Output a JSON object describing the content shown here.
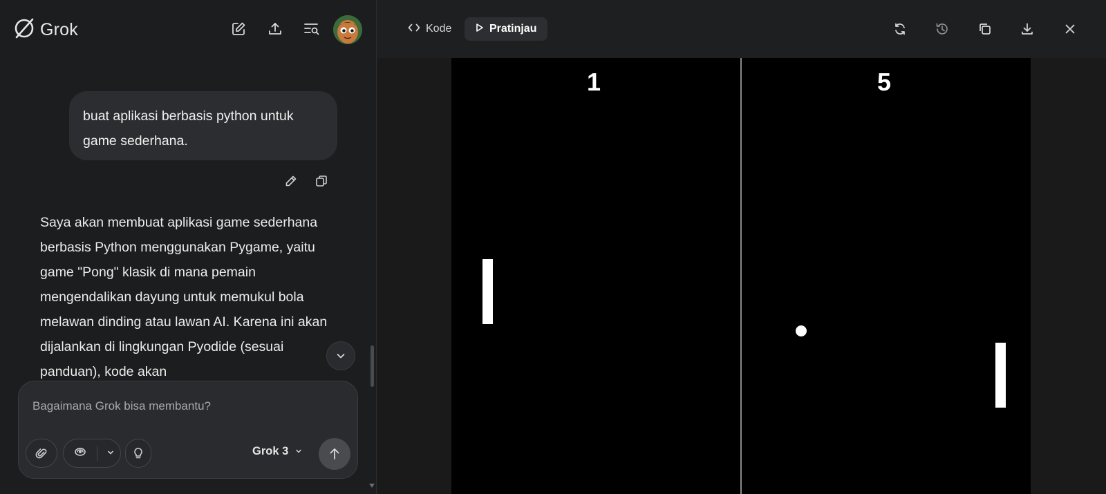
{
  "app": {
    "brand": "Grok",
    "avatar_icon": "user-avatar"
  },
  "header": {
    "icons": [
      "edit-icon",
      "share-icon",
      "search-history-icon"
    ]
  },
  "chat": {
    "user_message": "buat aplikasi berbasis python untuk game sederhana.",
    "message_actions": [
      "edit-icon",
      "copy-icon"
    ],
    "assistant_message": "Saya akan membuat aplikasi game sederhana berbasis Python menggunakan Pygame, yaitu game \"Pong\" klasik di mana pemain mengendalikan dayung untuk memukul bola melawan dinding atau lawan AI. Karena ini akan dijalankan di lingkungan Pyodide (sesuai panduan), kode akan"
  },
  "composer": {
    "placeholder": "Bagaimana Grok bisa membantu?",
    "model_label": "Grok 3"
  },
  "preview": {
    "tabs": [
      {
        "label": "Kode",
        "icon": "code-icon",
        "active": false
      },
      {
        "label": "Pratinjau",
        "icon": "play-icon",
        "active": true
      }
    ],
    "tools": [
      "refresh-icon",
      "history-icon",
      "copy-icon",
      "download-icon",
      "close-icon"
    ]
  },
  "game": {
    "score_left": "1",
    "score_right": "5"
  },
  "colors": {
    "background": "#1c1d1f",
    "bubble": "#2c2d30",
    "canvas": "#000000",
    "game_objects": "#ffffff"
  }
}
